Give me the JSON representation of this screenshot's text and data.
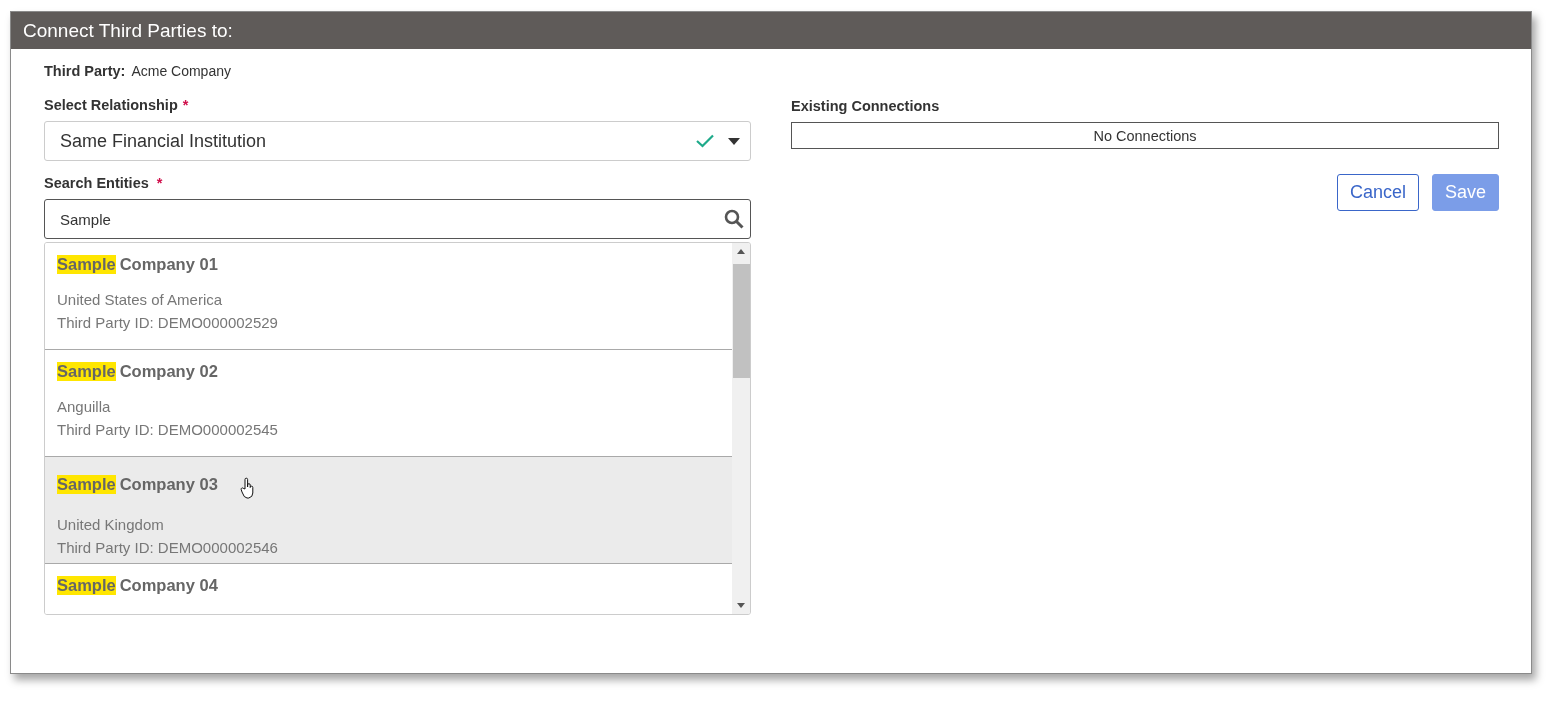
{
  "dialog": {
    "title": "Connect Third Parties to:"
  },
  "third_party": {
    "label": "Third Party:",
    "value": "Acme Company"
  },
  "relationship": {
    "label": "Select Relationship",
    "required": "*",
    "value": "Same Financial Institution",
    "valid": true
  },
  "search": {
    "label": "Search Entities",
    "required": "*",
    "value": "Sample"
  },
  "results": [
    {
      "match": "Sample",
      "rest": "Company 01",
      "country": "United States of America",
      "id_text": "Third Party ID: DEMO000002529",
      "hovered": false
    },
    {
      "match": "Sample",
      "rest": "Company 02",
      "country": "Anguilla",
      "id_text": "Third Party ID: DEMO000002545",
      "hovered": false
    },
    {
      "match": "Sample",
      "rest": "Company 03",
      "country": "United Kingdom",
      "id_text": "Third Party ID: DEMO000002546",
      "hovered": true
    },
    {
      "match": "Sample",
      "rest": "Company 04",
      "hovered": false
    }
  ],
  "existing_connections": {
    "label": "Existing Connections",
    "empty_text": "No Connections"
  },
  "buttons": [
    {
      "kind": "secondary",
      "label": "Cancel",
      "disabled": false
    },
    {
      "kind": "primary",
      "label": "Save",
      "disabled": true
    }
  ]
}
